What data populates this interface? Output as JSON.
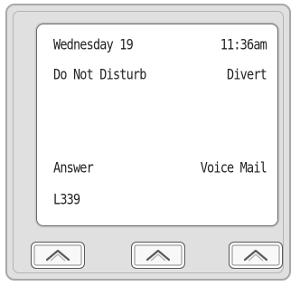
{
  "display": {
    "date": "Wednesday 19",
    "time": "11:36am",
    "line2_left": "Do Not Disturb",
    "line2_right": "Divert",
    "line3_left": "Answer",
    "line3_right": "Voice Mail",
    "line4_left": "L339"
  },
  "softkeys": [
    {
      "icon": "chevron-up-icon"
    },
    {
      "icon": "chevron-up-icon"
    },
    {
      "icon": "chevron-up-icon"
    }
  ],
  "colors": {
    "body": "#e0e0e0",
    "screen": "#ffffff",
    "text": "#222222"
  }
}
